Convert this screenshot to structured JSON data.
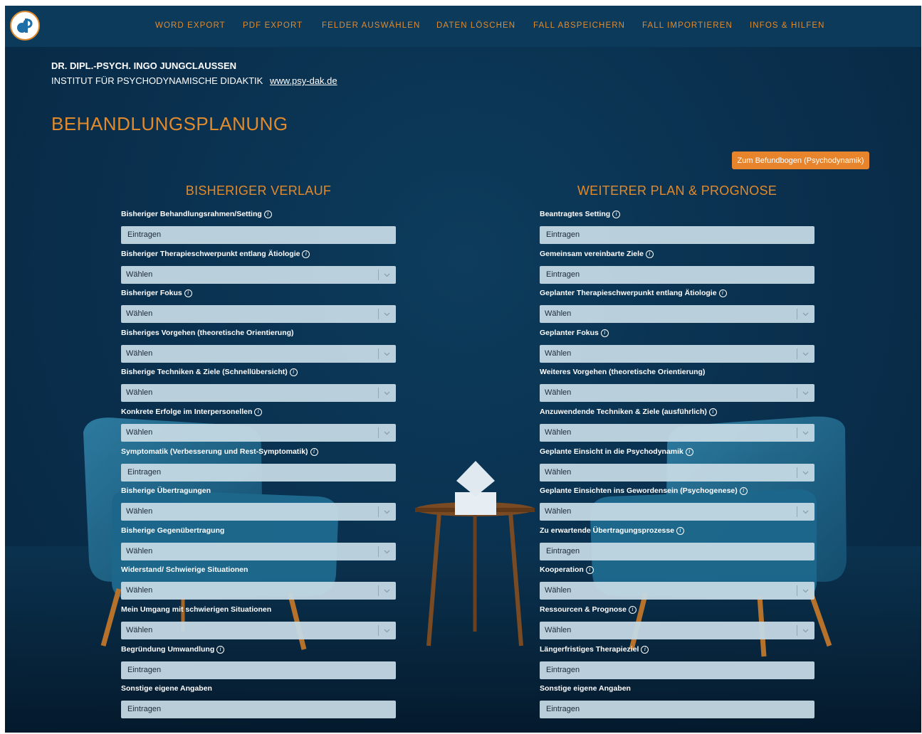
{
  "nav": {
    "items": [
      "WORD EXPORT",
      "PDF EXPORT",
      "FELDER AUSWÄHLEN",
      "DATEN LÖSCHEN",
      "FALL ABSPEICHERN",
      "FALL IMPORTIEREN",
      "INFOS & HILFEN"
    ]
  },
  "header": {
    "author": "DR. DIPL.-PSYCH. INGO JUNGCLAUSSEN",
    "institute": "INSTITUT FÜR PSYCHODYNAMISCHE DIDAKTIK",
    "website": "www.psy-dak.de"
  },
  "page_title": "BEHANDLUNGSPLANUNG",
  "befund_button": "Zum Befundbogen (Psychodynamik)",
  "colors": {
    "accent": "#e08a2e",
    "nav_bg": "#0c3a5a",
    "field_bg": "#c4d8e4"
  },
  "left": {
    "heading": "BISHERIGER VERLAUF",
    "fields": [
      {
        "label": "Bisheriger Behandlungsrahmen/Setting",
        "info": true,
        "type": "input",
        "value": "Eintragen"
      },
      {
        "label": "Bisheriger Therapieschwerpunkt entlang Ätiologie",
        "info": true,
        "type": "select",
        "value": "Wählen"
      },
      {
        "label": "Bisheriger Fokus",
        "info": true,
        "type": "select",
        "value": "Wählen"
      },
      {
        "label": "Bisheriges Vorgehen (theoretische Orientierung)",
        "info": false,
        "type": "select",
        "value": "Wählen"
      },
      {
        "label": "Bisherige Techniken & Ziele (Schnellübersicht)",
        "info": true,
        "type": "select",
        "value": "Wählen"
      },
      {
        "label": "Konkrete Erfolge im Interpersonellen",
        "info": true,
        "type": "select",
        "value": "Wählen"
      },
      {
        "label": "Symptomatik (Verbesserung und Rest-Symptomatik)",
        "info": true,
        "type": "input",
        "value": "Eintragen"
      },
      {
        "label": "Bisherige Übertragungen",
        "info": false,
        "type": "select",
        "value": "Wählen"
      },
      {
        "label": "Bisherige Gegenübertragung",
        "info": false,
        "type": "select",
        "value": "Wählen"
      },
      {
        "label": "Widerstand/ Schwierige Situationen",
        "info": false,
        "type": "select",
        "value": "Wählen"
      },
      {
        "label": "Mein Umgang mit schwierigen Situationen",
        "info": false,
        "type": "select",
        "value": "Wählen"
      },
      {
        "label": "Begründung Umwandlung",
        "info": true,
        "type": "input",
        "value": "Eintragen"
      },
      {
        "label": "Sonstige eigene Angaben",
        "info": false,
        "type": "input",
        "value": "Eintragen"
      }
    ]
  },
  "right": {
    "heading": "WEITERER PLAN & PROGNOSE",
    "fields": [
      {
        "label": "Beantragtes Setting",
        "info": true,
        "type": "input",
        "value": "Eintragen"
      },
      {
        "label": "Gemeinsam vereinbarte Ziele",
        "info": true,
        "type": "input",
        "value": "Eintragen"
      },
      {
        "label": "Geplanter Therapieschwerpunkt entlang Ätiologie",
        "info": true,
        "type": "select",
        "value": "Wählen"
      },
      {
        "label": "Geplanter Fokus",
        "info": true,
        "type": "select",
        "value": "Wählen"
      },
      {
        "label": "Weiteres Vorgehen (theoretische Orientierung)",
        "info": false,
        "type": "select",
        "value": "Wählen"
      },
      {
        "label": "Anzuwendende Techniken & Ziele (ausführlich)",
        "info": true,
        "type": "select",
        "value": "Wählen"
      },
      {
        "label": "Geplante Einsicht in die Psychodynamik",
        "info": true,
        "type": "select",
        "value": "Wählen"
      },
      {
        "label": "Geplante Einsichten ins Gewordensein (Psychogenese)",
        "info": true,
        "type": "select",
        "value": "Wählen"
      },
      {
        "label": "Zu erwartende Übertragungsprozesse",
        "info": true,
        "type": "input",
        "value": "Eintragen"
      },
      {
        "label": "Kooperation",
        "info": true,
        "type": "select",
        "value": "Wählen"
      },
      {
        "label": "Ressourcen & Prognose",
        "info": true,
        "type": "select",
        "value": "Wählen"
      },
      {
        "label": "Längerfristiges Therapieziel",
        "info": true,
        "type": "input",
        "value": "Eintragen"
      },
      {
        "label": "Sonstige eigene Angaben",
        "info": false,
        "type": "input",
        "value": "Eintragen"
      }
    ]
  }
}
